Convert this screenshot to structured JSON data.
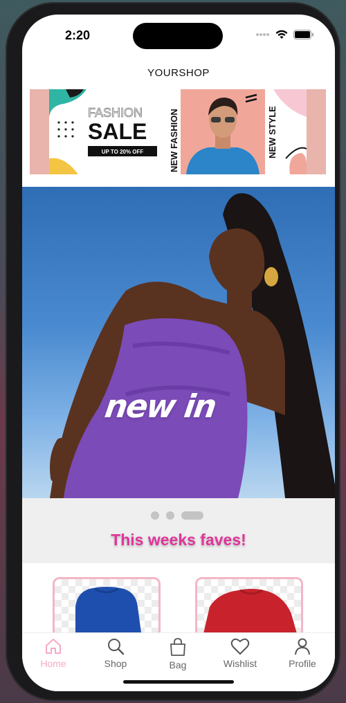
{
  "status_bar": {
    "time": "2:20"
  },
  "header": {
    "title": "YOURSHOP"
  },
  "promo_banner": {
    "fashion": "FASHION",
    "sale": "SALE",
    "discount": "UP TO 20% OFF",
    "new_fashion": "NEW FASHION",
    "new_style": "NEW STYLE"
  },
  "hero": {
    "text": "new in"
  },
  "carousel": {
    "page_count": 3,
    "active_index": 2
  },
  "section": {
    "title": "This weeks faves!"
  },
  "products": [
    {
      "color": "#1f4fae"
    },
    {
      "color": "#c8232c"
    }
  ],
  "tabs": [
    {
      "label": "Home",
      "icon": "home-icon",
      "active": true
    },
    {
      "label": "Shop",
      "icon": "search-icon",
      "active": false
    },
    {
      "label": "Bag",
      "icon": "bag-icon",
      "active": false
    },
    {
      "label": "Wishlist",
      "icon": "heart-icon",
      "active": false
    },
    {
      "label": "Profile",
      "icon": "person-icon",
      "active": false
    }
  ],
  "colors": {
    "accent_pink": "#e0359a",
    "tab_active": "#f4a9c6"
  }
}
